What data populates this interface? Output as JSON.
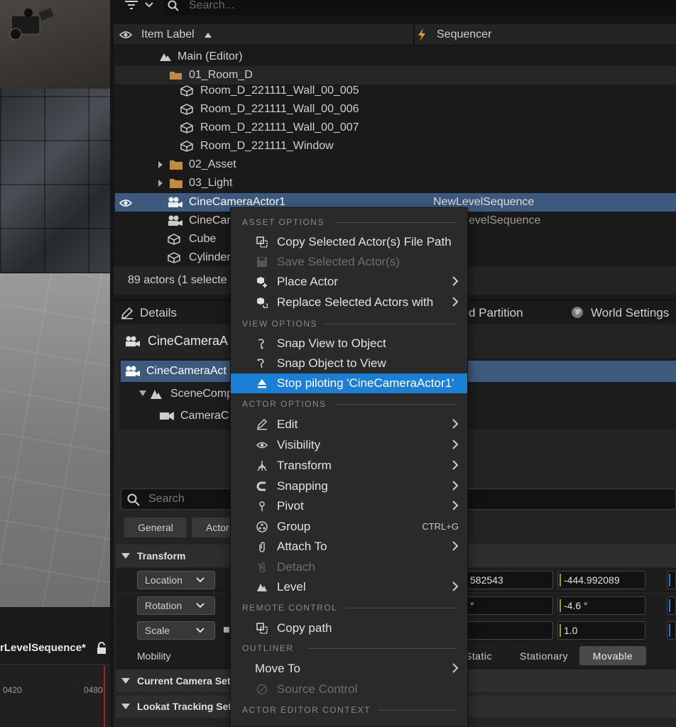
{
  "viewport": {
    "timeline_title": "rLevelSequence*",
    "ticks": [
      "0420",
      "0480"
    ]
  },
  "outliner": {
    "search_placeholder": "Search...",
    "col_item_label": "Item Label",
    "col_sequencer": "Sequencer",
    "rows": [
      {
        "label": "Main (Editor)",
        "seq": ""
      },
      {
        "label": "01_Room_D",
        "seq": ""
      },
      {
        "label": "Room_D_221111_Wall_00_005",
        "seq": ""
      },
      {
        "label": "Room_D_221111_Wall_00_006",
        "seq": ""
      },
      {
        "label": "Room_D_221111_Wall_00_007",
        "seq": ""
      },
      {
        "label": "Room_D_221111_Window",
        "seq": ""
      },
      {
        "label": "02_Asset",
        "seq": ""
      },
      {
        "label": "03_Light",
        "seq": ""
      },
      {
        "label": "CineCameraActor1",
        "seq": "NewLevelSequence"
      },
      {
        "label": "CineCar",
        "seq": "evelSequence"
      },
      {
        "label": "Cube",
        "seq": ""
      },
      {
        "label": "Cylinder",
        "seq": ""
      }
    ],
    "status": "89 actors (1 selecte"
  },
  "details": {
    "tab_details": "Details",
    "tab_world_partition": "d Partition",
    "tab_world_settings": "World Settings",
    "actor_name": "CineCameraA",
    "tree": [
      "CineCameraAct",
      "SceneComp",
      "CameraC"
    ],
    "search_placeholder": "Search",
    "filters": [
      "General",
      "Actor"
    ],
    "section_transform": "Transform",
    "location_label": "Location",
    "rotation_label": "Rotation",
    "scale_label": "Scale",
    "loc_x": "582543",
    "loc_y": "-444.992089",
    "rot_x": "°",
    "rot_y": "-4.6 °",
    "scale_y": "1.0",
    "mobility_label": "Mobility",
    "mobility_static": "Static",
    "mobility_stationary": "Stationary",
    "mobility_movable": "Movable",
    "section_camera": "Current Camera Setti",
    "section_lookat": "Lookat Tracking Setti"
  },
  "menu": {
    "sec_asset": "ASSET OPTIONS",
    "copy_path": "Copy Selected Actor(s) File Path",
    "save_actors": "Save Selected Actor(s)",
    "place_actor": "Place Actor",
    "replace_actors": "Replace Selected Actors with",
    "sec_view": "VIEW OPTIONS",
    "snap_view": "Snap View to Object",
    "snap_object": "Snap Object to View",
    "stop_piloting": "Stop piloting 'CineCameraActor1'",
    "sec_actor": "ACTOR OPTIONS",
    "edit": "Edit",
    "visibility": "Visibility",
    "transform": "Transform",
    "snapping": "Snapping",
    "pivot": "Pivot",
    "group": "Group",
    "group_shortcut": "CTRL+G",
    "attach_to": "Attach To",
    "detach": "Detach",
    "level": "Level",
    "sec_remote": "REMOTE CONTROL",
    "copy_path2": "Copy path",
    "sec_outliner": "OUTLINER",
    "move_to": "Move To",
    "source_control": "Source Control",
    "sec_actor_editor": "ACTOR EDITOR CONTEXT"
  }
}
